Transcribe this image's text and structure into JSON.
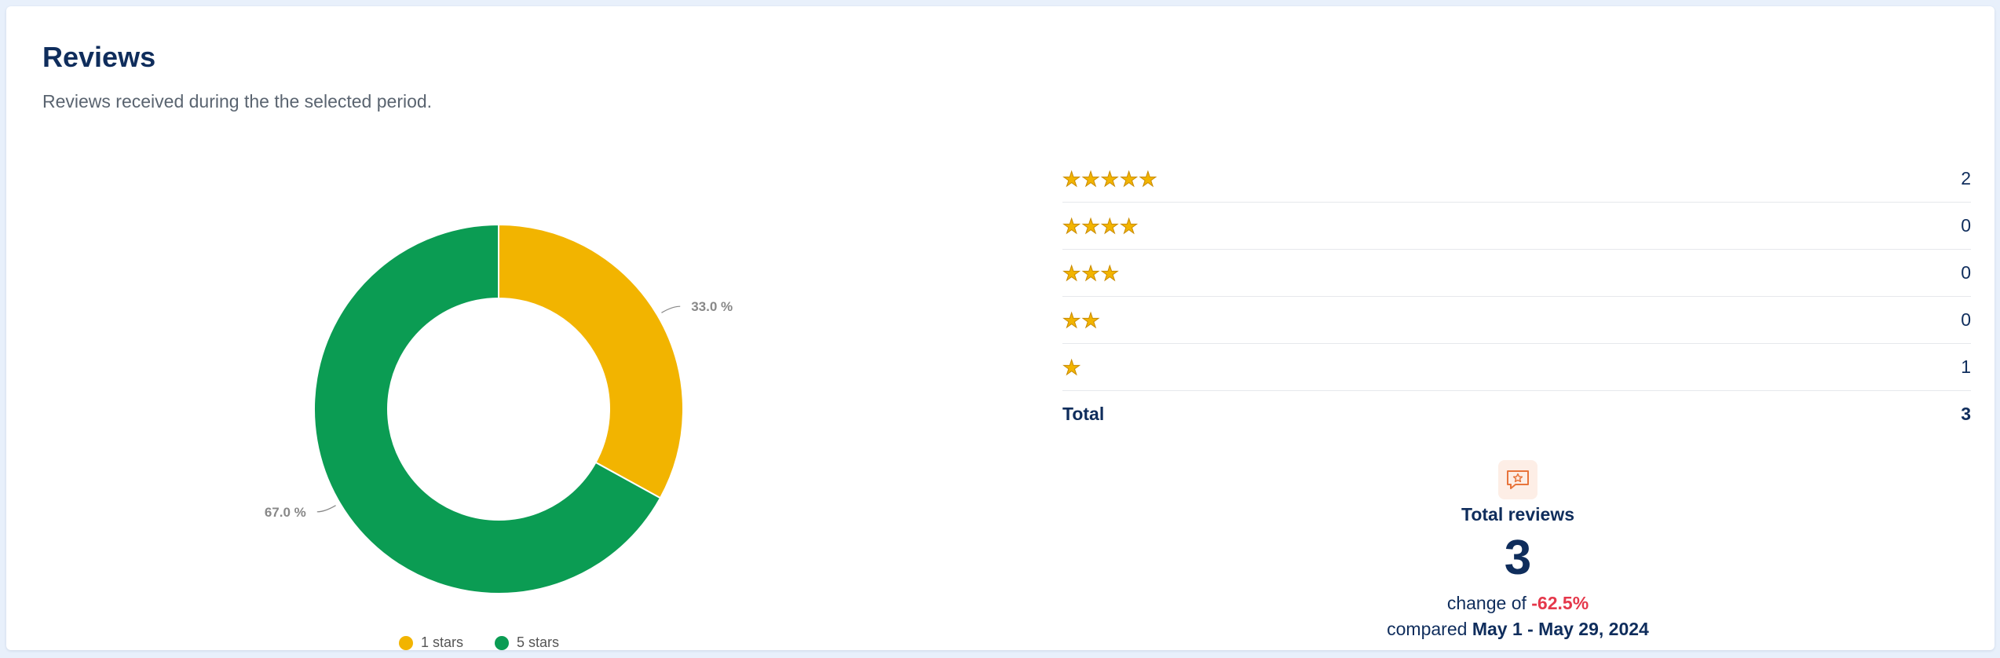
{
  "card": {
    "title": "Reviews",
    "subtitle": "Reviews received during the the selected period."
  },
  "chart_data": {
    "type": "pie",
    "style": "donut",
    "categories": [
      "1 stars",
      "5 stars"
    ],
    "values": [
      33.0,
      67.0
    ],
    "labels": [
      "33.0 %",
      "67.0 %"
    ],
    "colors": [
      "#f2b400",
      "#0b9c53"
    ],
    "legend": "bottom"
  },
  "ratings": {
    "rows": [
      {
        "stars": 5,
        "count": "2"
      },
      {
        "stars": 4,
        "count": "0"
      },
      {
        "stars": 3,
        "count": "0"
      },
      {
        "stars": 2,
        "count": "0"
      },
      {
        "stars": 1,
        "count": "1"
      }
    ],
    "total_label": "Total",
    "total_value": "3"
  },
  "summary": {
    "icon": "review-bubble-star-icon",
    "label": "Total reviews",
    "value": "3",
    "change_prefix": "change of",
    "change_value": "-62.5%",
    "compare_prefix": "compared",
    "compare_period": "May 1 - May 29, 2024"
  },
  "colors": {
    "title": "#0f2d5c",
    "negative": "#e5384b",
    "star": "#f2b400"
  }
}
